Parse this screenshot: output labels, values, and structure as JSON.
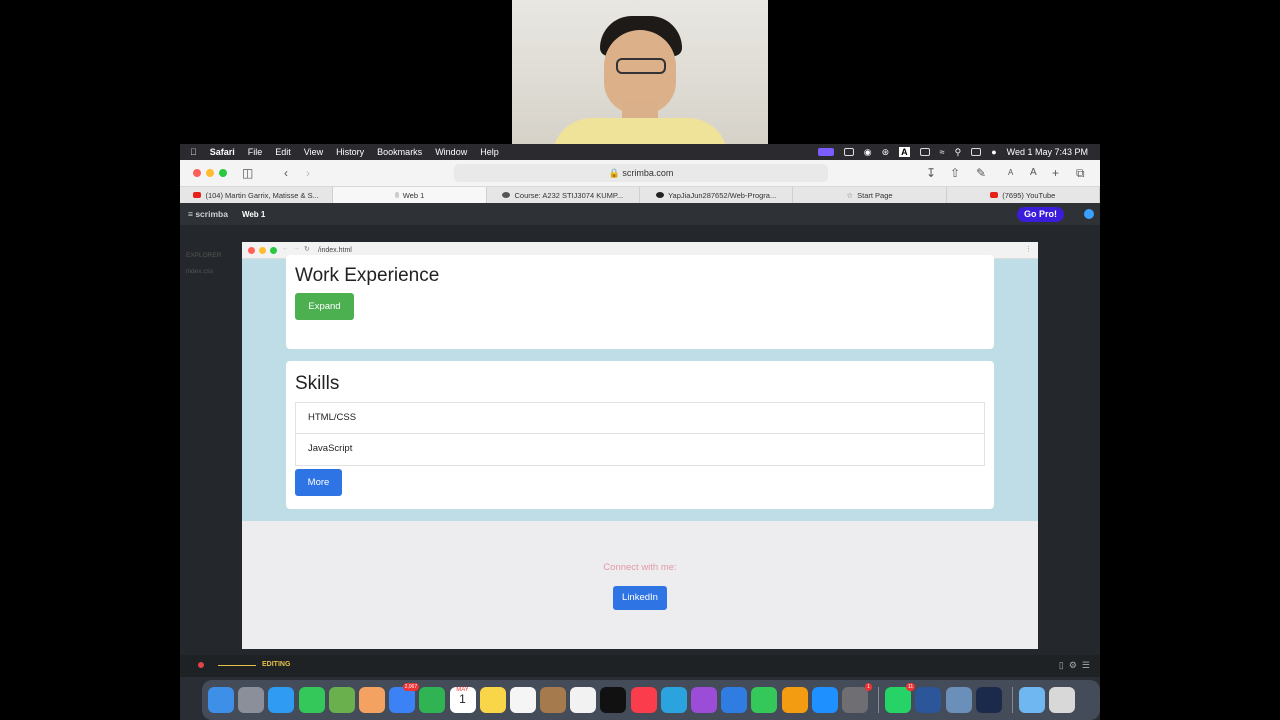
{
  "menubar": {
    "items": [
      "Safari",
      "File",
      "Edit",
      "View",
      "History",
      "Bookmarks",
      "Window",
      "Help"
    ],
    "clock": "Wed 1 May  7:43 PM"
  },
  "safari": {
    "url": "scrimba.com",
    "tabs": [
      {
        "label": "(104) Martin Garrix, Matisse & S...",
        "color": "#e62117"
      },
      {
        "label": "Web 1",
        "color": "#ffffff"
      },
      {
        "label": "Course: A232 STIJ3074 KUMP...",
        "color": "#555555"
      },
      {
        "label": "YapJiaJun287652/Web-Progra...",
        "color": "#222222"
      },
      {
        "label": "Start Page",
        "color": "#888888"
      },
      {
        "label": "(7695) YouTube",
        "color": "#e62117"
      }
    ]
  },
  "scrimba": {
    "logo": "scrimba",
    "project": "Web 1",
    "go_pro": "Go Pro!"
  },
  "editor": {
    "explorer_title": "EXPLORER",
    "files": [
      "index.css"
    ]
  },
  "preview": {
    "url": "/index.html",
    "work_title": "Work Experience",
    "expand_label": "Expand",
    "skills_title": "Skills",
    "skills": [
      "HTML/CSS",
      "JavaScript"
    ],
    "more_label": "More",
    "connect_text": "Connect with me:",
    "linkedin_label": "LinkedIn"
  },
  "status": {
    "editing": "EDITING"
  },
  "dock": {
    "icons": [
      {
        "name": "finder-icon",
        "color": "#3d8fe8"
      },
      {
        "name": "launchpad-icon",
        "color": "#8a8f99"
      },
      {
        "name": "safari-icon",
        "color": "#2f9bf2"
      },
      {
        "name": "messages-icon",
        "color": "#34c759"
      },
      {
        "name": "maps-icon",
        "color": "#6ab04c"
      },
      {
        "name": "photos-icon",
        "color": "#f4a261"
      },
      {
        "name": "mail-icon",
        "color": "#3b82f6"
      },
      {
        "name": "facetime-icon",
        "color": "#30b352"
      },
      {
        "name": "calendar-icon",
        "color": "#ffffff"
      },
      {
        "name": "notes-icon",
        "color": "#f9d648"
      },
      {
        "name": "freeform-icon",
        "color": "#f5f5f5"
      },
      {
        "name": "archive-icon",
        "color": "#a57a4c"
      },
      {
        "name": "reminders-icon",
        "color": "#f2f2f2"
      },
      {
        "name": "apple-tv-icon",
        "color": "#111111"
      },
      {
        "name": "music-icon",
        "color": "#fa3c4c"
      },
      {
        "name": "telegram-icon",
        "color": "#2aa3de"
      },
      {
        "name": "podcasts-icon",
        "color": "#9b4dd8"
      },
      {
        "name": "keynote-icon",
        "color": "#2f7de1"
      },
      {
        "name": "numbers-icon",
        "color": "#34c759"
      },
      {
        "name": "pages-icon",
        "color": "#f39c12"
      },
      {
        "name": "app-store-icon",
        "color": "#1e90ff"
      },
      {
        "name": "system-settings-icon",
        "color": "#6e6e73"
      },
      {
        "name": "whatsapp-icon",
        "color": "#25d366"
      },
      {
        "name": "word-icon",
        "color": "#2b579a"
      },
      {
        "name": "preview-icon",
        "color": "#6a8fb8"
      },
      {
        "name": "webex-icon",
        "color": "#1b2a4a"
      },
      {
        "name": "downloads-folder-icon",
        "color": "#6fb7f0"
      },
      {
        "name": "trash-icon",
        "color": "#d8d8d8"
      }
    ],
    "badges": {
      "mail": "2,067",
      "system": "1",
      "whatsapp": "11"
    },
    "calendar": {
      "month": "MAY",
      "day": "1"
    }
  }
}
